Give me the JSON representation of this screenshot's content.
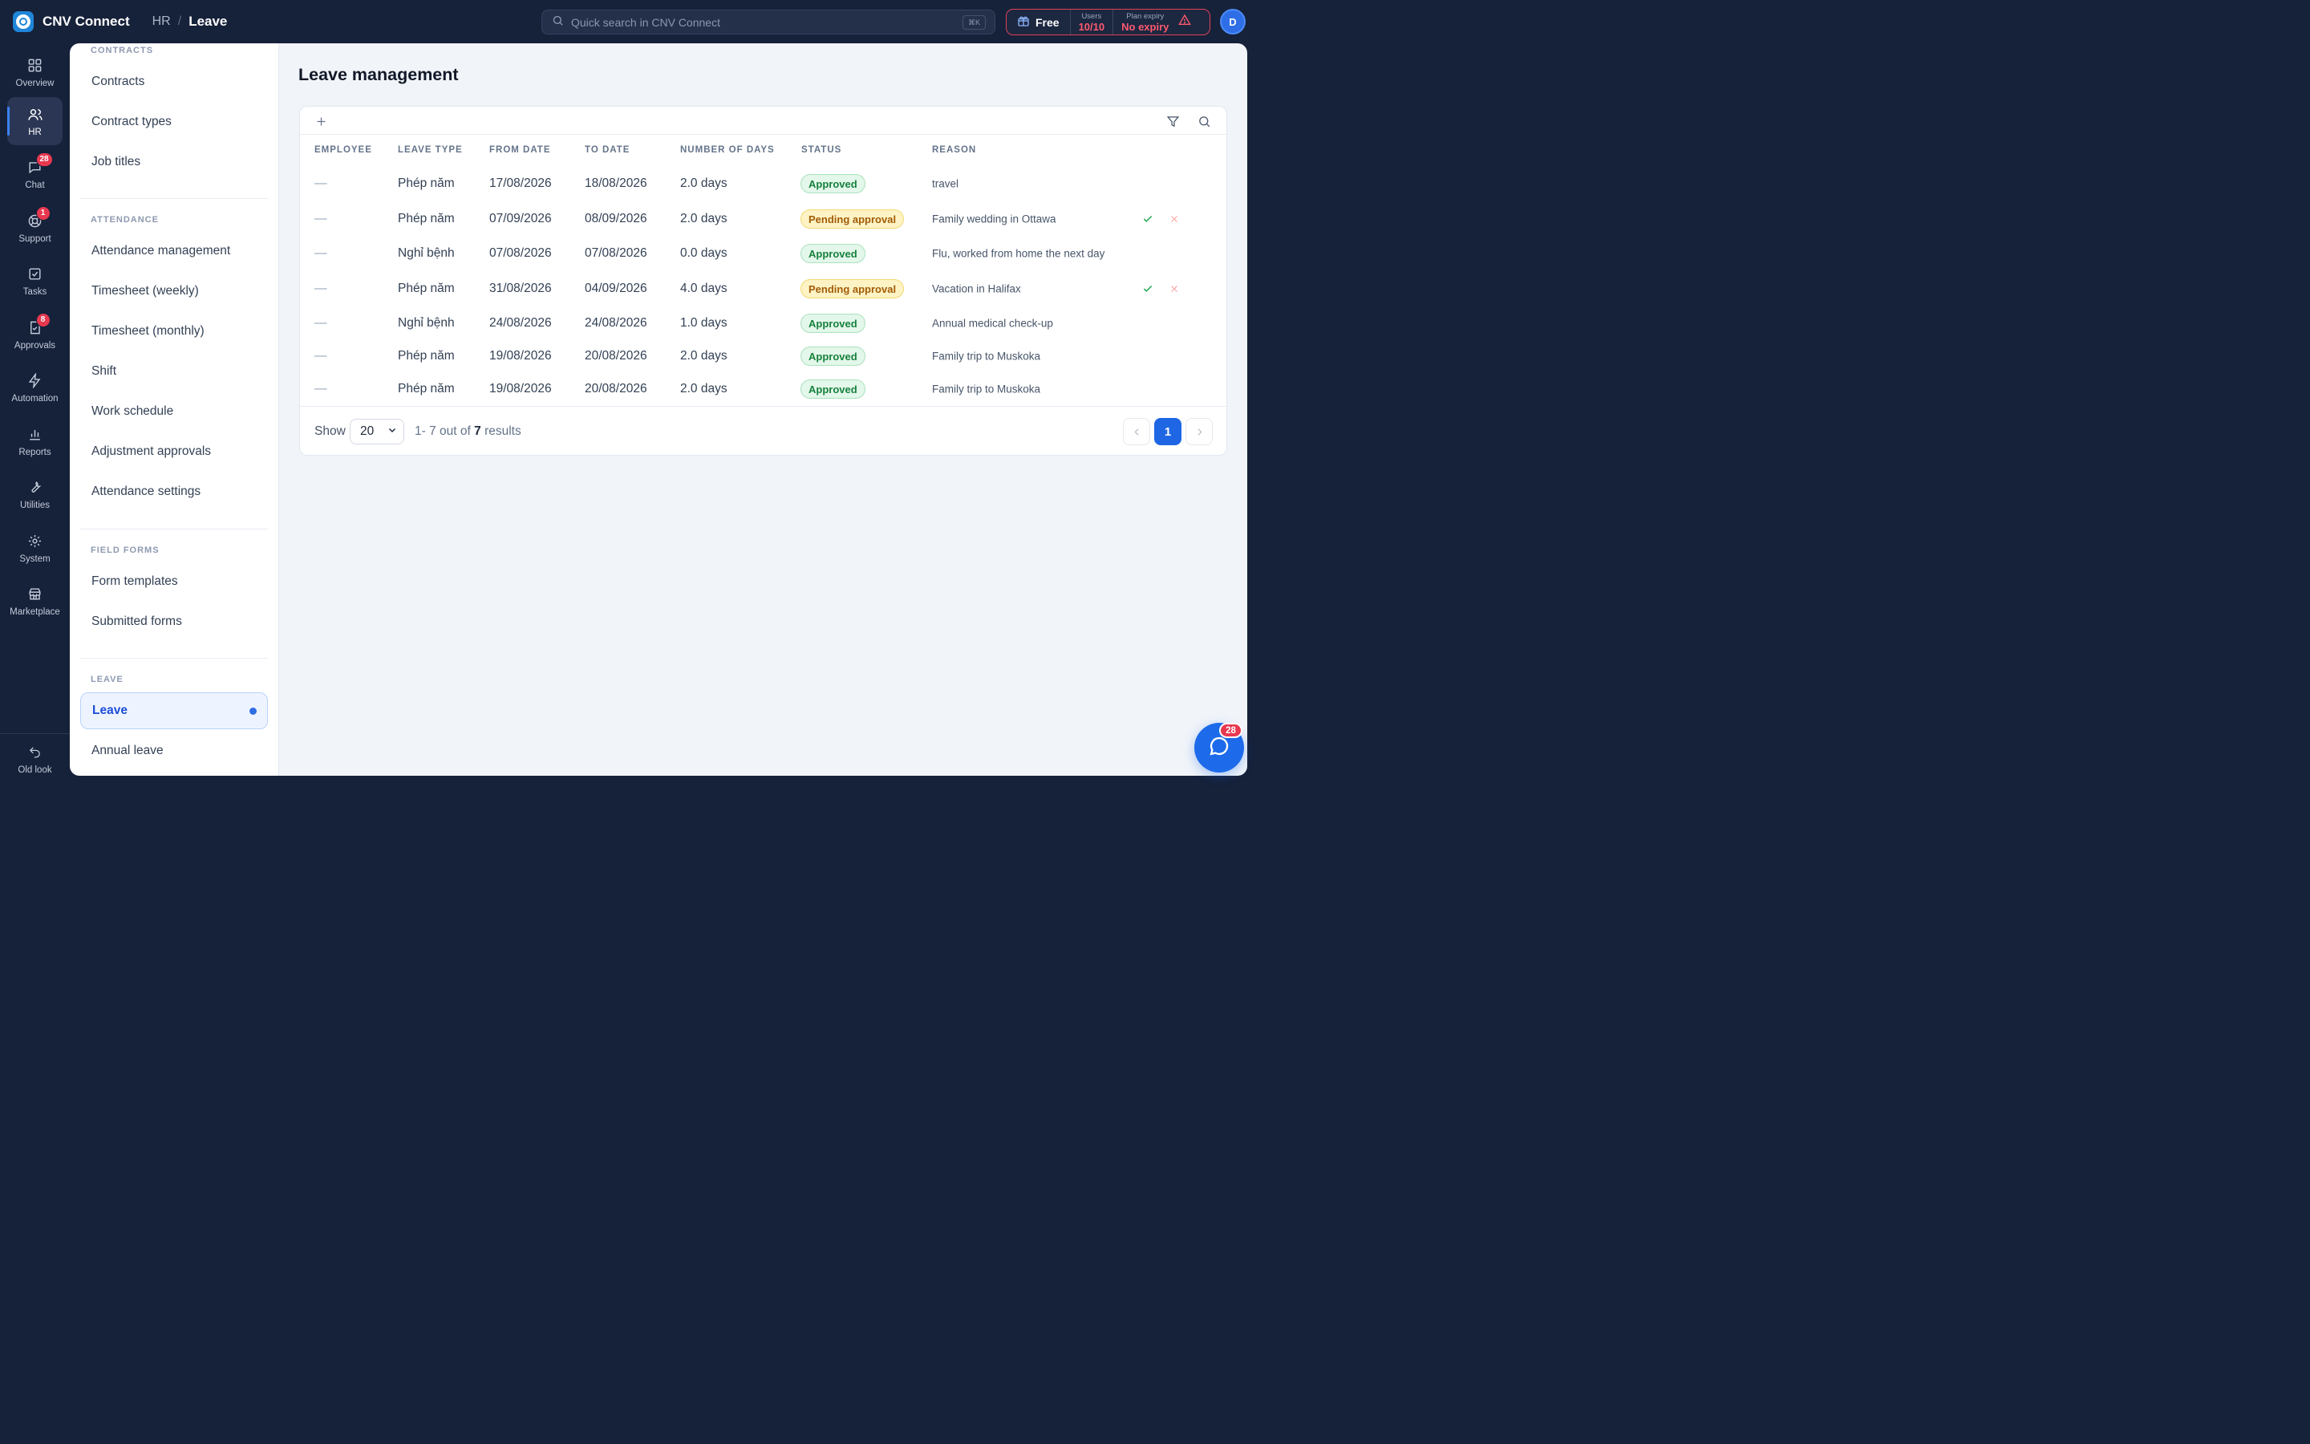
{
  "app": {
    "name": "CNV Connect"
  },
  "breadcrumb": {
    "parent": "HR",
    "separator": "/",
    "current": "Leave"
  },
  "search": {
    "placeholder": "Quick search in CNV Connect",
    "shortcut": "⌘K"
  },
  "plan": {
    "name": "Free",
    "users_label": "Users",
    "users_value": "10/10",
    "expiry_label": "Plan expiry",
    "expiry_value": "No expiry",
    "alert_color": "#e04356"
  },
  "user": {
    "avatar_initial": "D"
  },
  "rail": [
    {
      "id": "overview",
      "label": "Overview",
      "icon": "grid-icon"
    },
    {
      "id": "hr",
      "label": "HR",
      "icon": "users-icon",
      "active": true
    },
    {
      "id": "chat",
      "label": "Chat",
      "icon": "chat-icon",
      "badge": "28"
    },
    {
      "id": "support",
      "label": "Support",
      "icon": "support-icon",
      "badge": "1"
    },
    {
      "id": "tasks",
      "label": "Tasks",
      "icon": "task-check-icon"
    },
    {
      "id": "approvals",
      "label": "Approvals",
      "icon": "approvals-icon",
      "badge": "8"
    },
    {
      "id": "automation",
      "label": "Automation",
      "icon": "lightning-icon"
    },
    {
      "id": "reports",
      "label": "Reports",
      "icon": "bar-chart-icon"
    },
    {
      "id": "utilities",
      "label": "Utilities",
      "icon": "wrench-icon"
    },
    {
      "id": "system",
      "label": "System",
      "icon": "gear-icon"
    },
    {
      "id": "marketplace",
      "label": "Marketplace",
      "icon": "store-icon"
    }
  ],
  "old_look": {
    "label": "Old look",
    "icon": "undo-icon"
  },
  "subnav": {
    "sections": [
      {
        "label": "CONTRACTS",
        "items": [
          "Contracts",
          "Contract types",
          "Job titles"
        ]
      },
      {
        "label": "ATTENDANCE",
        "items": [
          "Attendance management",
          "Timesheet (weekly)",
          "Timesheet (monthly)",
          "Shift",
          "Work schedule",
          "Adjustment approvals",
          "Attendance settings"
        ]
      },
      {
        "label": "FIELD FORMS",
        "items": [
          "Form templates",
          "Submitted forms"
        ]
      },
      {
        "label": "LEAVE",
        "items": [
          "Leave",
          "Annual leave"
        ]
      }
    ]
  },
  "page": {
    "title": "Leave management"
  },
  "table": {
    "columns": [
      "EMPLOYEE",
      "LEAVE TYPE",
      "FROM DATE",
      "TO DATE",
      "NUMBER OF DAYS",
      "STATUS",
      "REASON"
    ],
    "rows": [
      {
        "employee": "—",
        "leave_type": "Phép năm",
        "from": "17/08/2026",
        "to": "18/08/2026",
        "days": "2.0 days",
        "status": "Approved",
        "status_kind": "approved",
        "reason": "travel",
        "actions": false
      },
      {
        "employee": "—",
        "leave_type": "Phép năm",
        "from": "07/09/2026",
        "to": "08/09/2026",
        "days": "2.0 days",
        "status": "Pending approval",
        "status_kind": "pending",
        "reason": "Family wedding in Ottawa",
        "actions": true
      },
      {
        "employee": "—",
        "leave_type": "Nghỉ bệnh",
        "from": "07/08/2026",
        "to": "07/08/2026",
        "days": "0.0 days",
        "status": "Approved",
        "status_kind": "approved",
        "reason": "Flu, worked from home the next day",
        "actions": false
      },
      {
        "employee": "—",
        "leave_type": "Phép năm",
        "from": "31/08/2026",
        "to": "04/09/2026",
        "days": "4.0 days",
        "status": "Pending approval",
        "status_kind": "pending",
        "reason": "Vacation in Halifax",
        "actions": true
      },
      {
        "employee": "—",
        "leave_type": "Nghỉ bệnh",
        "from": "24/08/2026",
        "to": "24/08/2026",
        "days": "1.0 days",
        "status": "Approved",
        "status_kind": "approved",
        "reason": "Annual medical check-up",
        "actions": false
      },
      {
        "employee": "—",
        "leave_type": "Phép năm",
        "from": "19/08/2026",
        "to": "20/08/2026",
        "days": "2.0 days",
        "status": "Approved",
        "status_kind": "approved",
        "reason": "Family trip to Muskoka",
        "actions": false
      },
      {
        "employee": "—",
        "leave_type": "Phép năm",
        "from": "19/08/2026",
        "to": "20/08/2026",
        "days": "2.0 days",
        "status": "Approved",
        "status_kind": "approved",
        "reason": "Family trip to Muskoka",
        "actions": false
      }
    ]
  },
  "pagination": {
    "show_label": "Show",
    "page_size": "20",
    "range": "1- 7",
    "out_of": "out of",
    "total": "7",
    "results_word": "results",
    "current_page": "1"
  },
  "chat_fab": {
    "badge": "28"
  },
  "colors": {
    "accent": "#1f66e5",
    "approved": "#17803d",
    "pending": "#a15c07",
    "badge": "#e8384f",
    "dark": "#16213a"
  }
}
